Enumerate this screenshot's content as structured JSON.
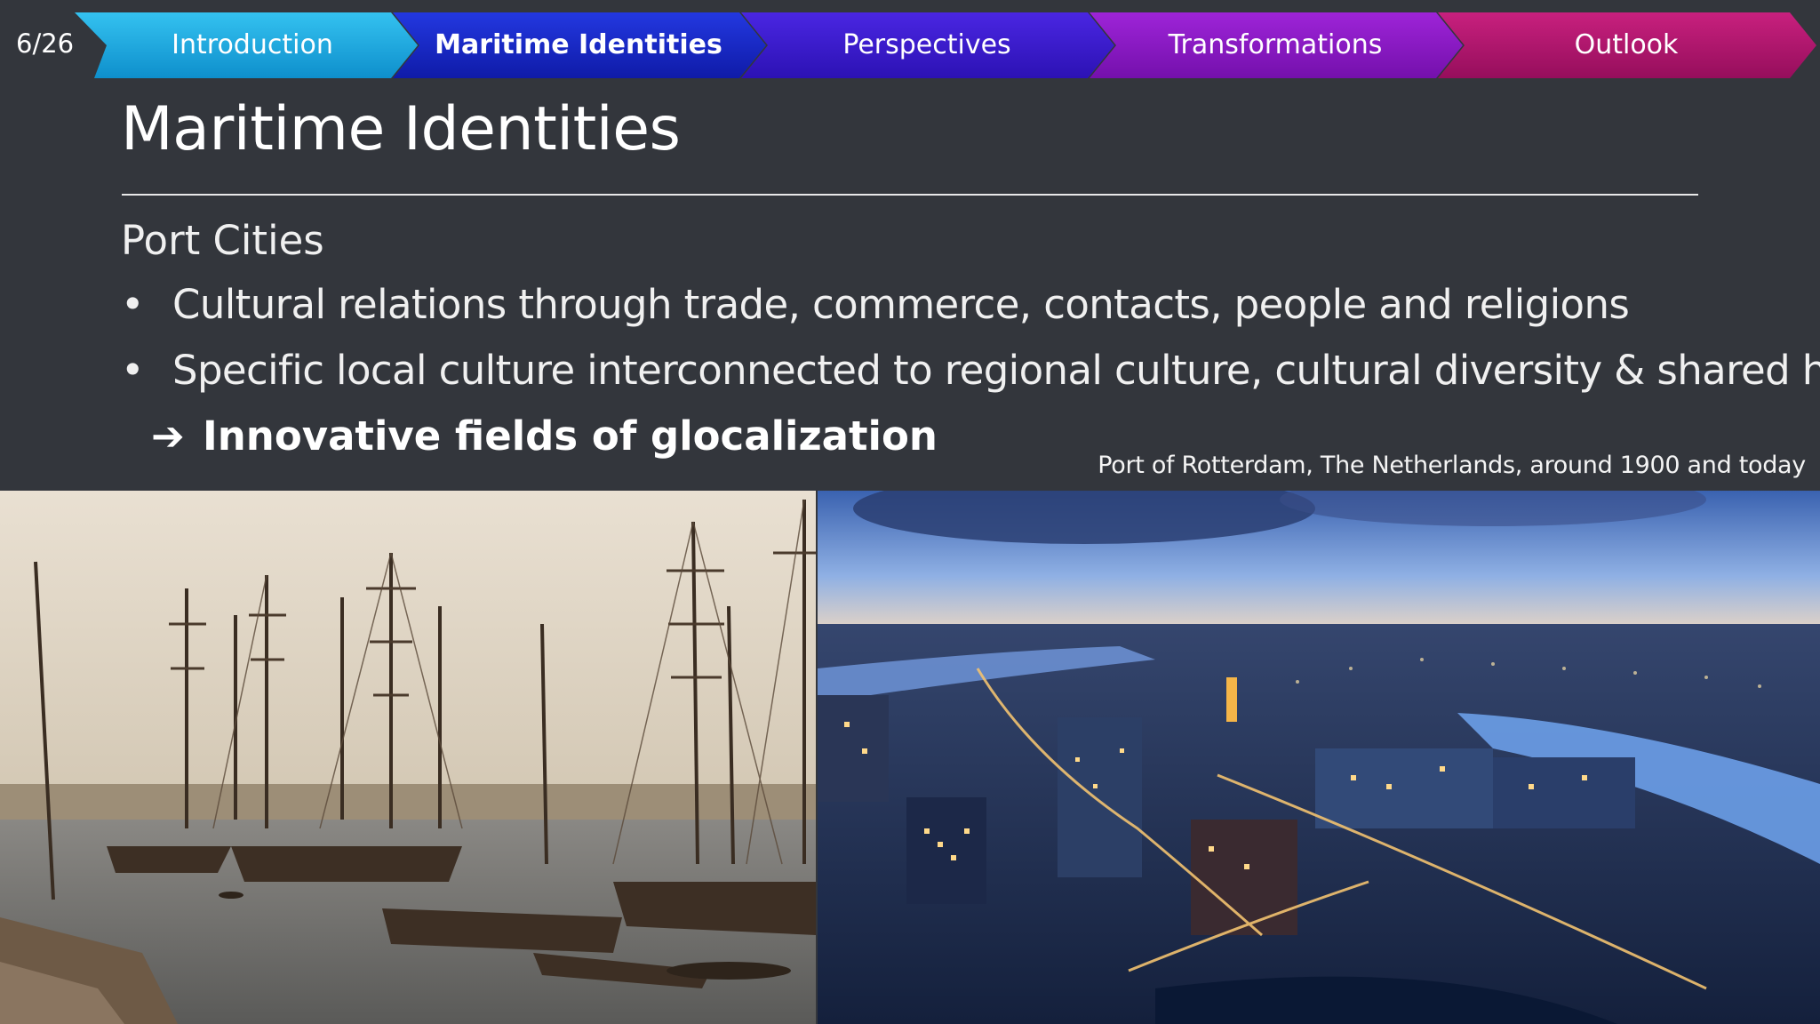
{
  "slide": {
    "page_number": "6/26",
    "nav": {
      "items": [
        {
          "label": "Introduction",
          "color": "#1aa6dc",
          "active": false
        },
        {
          "label": "Maritime Identities",
          "color": "#1a2fc8",
          "active": true
        },
        {
          "label": "Perspectives",
          "color": "#3b1bd0",
          "active": false
        },
        {
          "label": "Transformations",
          "color": "#8a16c4",
          "active": false
        },
        {
          "label": "Outlook",
          "color": "#b0146e",
          "active": false
        }
      ]
    },
    "title": "Maritime Identities",
    "subheading": "Port Cities",
    "bullets": [
      "Cultural relations through trade, commerce, contacts, people and religions",
      "Specific local culture interconnected to regional culture, cultural diversity & shared heritage"
    ],
    "conclusion_arrow": "➔",
    "conclusion": "Innovative fields of glocalization",
    "bullet_symbol": "•",
    "image_caption": "Port of Rotterdam, The Netherlands, around 1900 and today",
    "images": [
      {
        "name": "historic-harbor-photo",
        "description_icon": "sailing-ships"
      },
      {
        "name": "modern-rotterdam-photo",
        "description_icon": "city-skyline-dusk"
      }
    ]
  }
}
